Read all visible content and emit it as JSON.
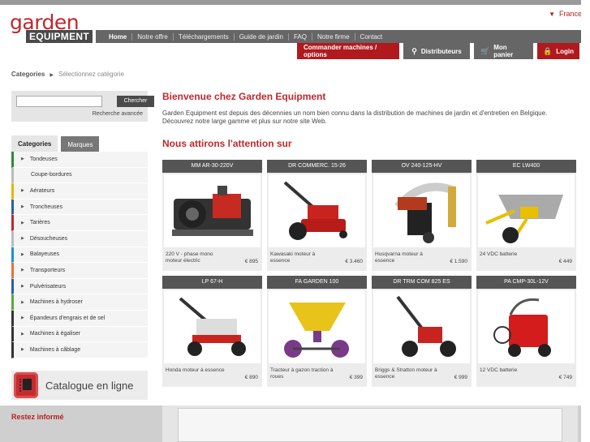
{
  "header": {
    "language": "France",
    "logo_top": "garden",
    "logo_bottom": "EQUIPMENT",
    "nav": [
      "Home",
      "Notre offre",
      "Téléchargements",
      "Guide de jardin",
      "FAQ",
      "Notre firme",
      "Contact"
    ],
    "actions": {
      "order": "Commander machines / options",
      "distributors": "Distributeurs",
      "cart": "Mon panier",
      "login": "Login"
    }
  },
  "breadcrumb": {
    "root": "Categories",
    "current": "Sélectionnez catégorie"
  },
  "search": {
    "button": "Chercher",
    "advanced": "Recherche avancée",
    "value": ""
  },
  "sidebar": {
    "tabs": [
      "Categories",
      "Marques"
    ],
    "categories": [
      {
        "label": "Tondeuses",
        "color": "#2e8b3a",
        "arrow": true
      },
      {
        "label": "Coupe-bordures",
        "color": "#bbbbbb",
        "arrow": false
      },
      {
        "label": "Aérateurs",
        "color": "#e8b400",
        "arrow": true
      },
      {
        "label": "Troncheuses",
        "color": "#2b5ea8",
        "arrow": true
      },
      {
        "label": "Tarières",
        "color": "#c0282d",
        "arrow": true
      },
      {
        "label": "Désoucheuses",
        "color": "#bbbbbb",
        "arrow": true
      },
      {
        "label": "Balayeuses",
        "color": "#1e90d6",
        "arrow": true
      },
      {
        "label": "Transporteurs",
        "color": "#e8703a",
        "arrow": true
      },
      {
        "label": "Pulvérisateurs",
        "color": "#2b5ea8",
        "arrow": true
      },
      {
        "label": "Machines à hydroser",
        "color": "#5aaa3a",
        "arrow": true
      },
      {
        "label": "Épandeurs d'engrais et de sel",
        "color": "#333333",
        "arrow": true
      },
      {
        "label": "Machines à égaliser",
        "color": "#333333",
        "arrow": true
      },
      {
        "label": "Machines à câblage",
        "color": "#333333",
        "arrow": true
      }
    ],
    "catalogue": "Catalogue en ligne"
  },
  "main": {
    "welcome": "Bienvenue chez Garden Equipment",
    "intro": "Garden Equipment est depuis des décennies un nom bien connu dans la distribution de machines de jardin et d'entretien en Belgique. Découvrez notre large gamme et plus sur notre site Web.",
    "attention": "Nous attirons l'attention sur",
    "products": [
      {
        "name": "MM AR-30-220V",
        "desc": "220 V - phase mono moteur électric",
        "price": "€ 895",
        "icon": "pump-icon"
      },
      {
        "name": "DR COMMERC. 15-26",
        "desc": "Kawasaki moteur à essence",
        "price": "€ 3.460",
        "icon": "brush-mower-icon"
      },
      {
        "name": "OV 240-125-HV",
        "desc": "Husqvarna moteur à essence",
        "price": "€ 1.590",
        "icon": "leaf-vacuum-icon"
      },
      {
        "name": "EC LW400",
        "desc": "24 VDC batterie",
        "price": "€ 449",
        "icon": "wheelbarrow-icon"
      },
      {
        "name": "LP 67-H",
        "desc": "Honda moteur à essence",
        "price": "€ 890",
        "icon": "dethatcher-icon"
      },
      {
        "name": "FA GARDEN 100",
        "desc": "Tracteur à gazon traction à roues",
        "price": "€ 399",
        "icon": "spreader-icon"
      },
      {
        "name": "DR TRM COM 825 ES",
        "desc": "Briggs & Stratton moteur à essence",
        "price": "€ 999",
        "icon": "string-trimmer-icon"
      },
      {
        "name": "PA CMP-30L-12V",
        "desc": "12 VDC batterie",
        "price": "€ 749",
        "icon": "sprayer-icon"
      }
    ]
  },
  "footer": {
    "newsletter": "Restez informé"
  }
}
